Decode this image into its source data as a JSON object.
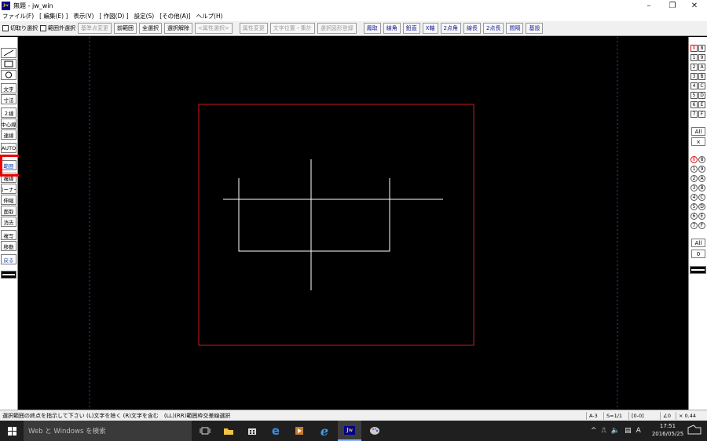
{
  "window": {
    "title": "無題 - jw_win",
    "app_logo": "Jw"
  },
  "menu": [
    "ファイル(F)",
    "[ 編集(E) ]",
    "表示(V)",
    "[ 作図(D) ]",
    "設定(S)",
    "[その他(A)]",
    "ヘルプ(H)"
  ],
  "toolbar": {
    "checks": [
      "切取り選択",
      "範囲外選択"
    ],
    "buttons1": [
      {
        "label": "基準点変更",
        "enabled": false
      },
      {
        "label": "前範囲",
        "enabled": true
      },
      {
        "label": "全選択",
        "enabled": true
      },
      {
        "label": "選択解除",
        "enabled": true
      },
      {
        "label": "<属性選択>",
        "enabled": false
      }
    ],
    "buttons2": [
      {
        "label": "属性変更",
        "enabled": false
      },
      {
        "label": "文字位置・集計",
        "enabled": false
      },
      {
        "label": "選択図形登録",
        "enabled": false
      }
    ],
    "buttons3": [
      "鳳取",
      "線角",
      "鉛直",
      "X軸",
      "2点角",
      "線長",
      "2点長",
      "間隔",
      "基設"
    ]
  },
  "left_tools": [
    {
      "name": "line",
      "label": ""
    },
    {
      "name": "rectangle",
      "label": ""
    },
    {
      "name": "circle",
      "label": ""
    },
    {
      "name": "text",
      "label": "文字"
    },
    {
      "name": "dimension",
      "label": "寸法"
    },
    {
      "name": "double-line",
      "label": "２線"
    },
    {
      "name": "center-line",
      "label": "中心線"
    },
    {
      "name": "continuous-line",
      "label": "連線"
    },
    {
      "name": "auto",
      "label": "AUTO"
    },
    {
      "name": "range",
      "label": "範囲"
    },
    {
      "name": "complex-line",
      "label": "複線"
    },
    {
      "name": "corner",
      "label": "コーナー"
    },
    {
      "name": "stretch",
      "label": "伸縮"
    },
    {
      "name": "erase-face",
      "label": "面取"
    },
    {
      "name": "erase",
      "label": "消去"
    },
    {
      "name": "copy",
      "label": "複写"
    },
    {
      "name": "move",
      "label": "移動"
    },
    {
      "name": "undo",
      "label": "戻る"
    }
  ],
  "layer_groups_top": [
    "0",
    "8",
    "1",
    "9",
    "2",
    "A",
    "3",
    "B",
    "4",
    "C",
    "5",
    "D",
    "6",
    "E",
    "7",
    "F"
  ],
  "layers_bottom": [
    "0",
    "8",
    "1",
    "9",
    "2",
    "A",
    "3",
    "B",
    "4",
    "C",
    "5",
    "D",
    "6",
    "E",
    "7",
    "F"
  ],
  "right_buttons": {
    "all_top": "All",
    "cross": "×",
    "all_bottom": "All",
    "zero": "0"
  },
  "status": {
    "message": "選択範囲の終点を指示して下さい (L)文字を除く (R)文字を含む　(LL)(RR)範囲枠交差線選択",
    "paper": "A-3",
    "scale": "S=1/1",
    "layer": "[0-0]",
    "angle": "∠0",
    "zoom": "× 0.44"
  },
  "taskbar": {
    "search_placeholder": "Web と Windows を検索",
    "ime": "A",
    "time": "17:51",
    "date": "2016/05/25"
  },
  "colors": {
    "canvas_bg": "#000000",
    "drawing_lines": "#ffffff",
    "selection_frame": "#d01a1a",
    "paper_border": "#6a2fa8",
    "highlight": "#ee0000"
  }
}
